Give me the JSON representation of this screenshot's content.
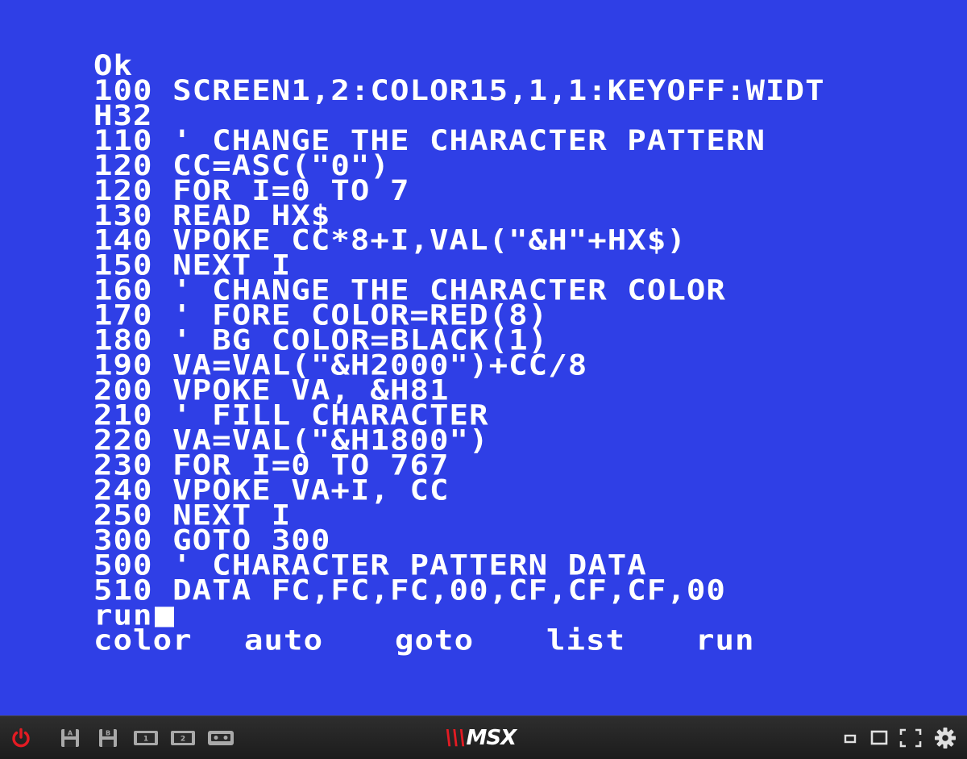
{
  "screen": {
    "background": "#2f3fe6",
    "foreground": "#ffffff",
    "lines": [
      "Ok",
      "100 SCREEN1,2:COLOR15,1,1:KEYOFF:WIDT",
      "H32",
      "110 ' CHANGE THE CHARACTER PATTERN",
      "120 CC=ASC(\"0\")",
      "120 FOR I=0 TO 7",
      "130 READ HX$",
      "140 VPOKE CC*8+I,VAL(\"&H\"+HX$)",
      "150 NEXT I",
      "160 ' CHANGE THE CHARACTER COLOR",
      "170 ' FORE COLOR=RED(8)",
      "180 ' BG COLOR=BLACK(1)",
      "190 VA=VAL(\"&H2000\")+CC/8",
      "200 VPOKE VA, &H81",
      "210 ' FILL CHARACTER",
      "220 VA=VAL(\"&H1800\")",
      "230 FOR I=0 TO 767",
      "240 VPOKE VA+I, CC",
      "250 NEXT I",
      "300 GOTO 300",
      "500 ' CHARACTER PATTERN DATA",
      "510 DATA FC,FC,FC,00,CF,CF,CF,00"
    ],
    "input_line": "run",
    "function_keys": [
      "color",
      "auto",
      "goto",
      "list",
      "run"
    ]
  },
  "toolbar": {
    "logo_text": "MSX",
    "logo_mark": "\\\\\\",
    "left_icons": [
      "power-icon",
      "disk-a-icon",
      "disk-b-icon",
      "cartridge-1-icon",
      "cartridge-2-icon",
      "tape-icon"
    ],
    "right_icons": [
      "small-screen-icon",
      "window-screen-icon",
      "fullscreen-icon",
      "gear-icon"
    ],
    "accent_color": "#e31b23"
  }
}
